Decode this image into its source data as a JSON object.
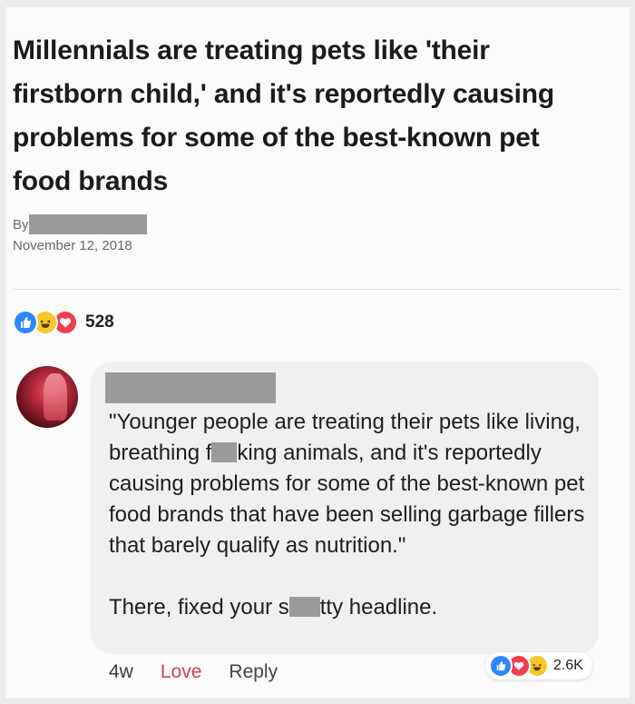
{
  "article": {
    "headline": "Millennials are treating pets like 'their firstborn child,' and it's reportedly causing problems for some of the best-known pet food brands",
    "byline_label": "By",
    "date": "November 12, 2018"
  },
  "post_reactions": {
    "count": "528",
    "icons": [
      "like-icon",
      "haha-icon",
      "love-icon"
    ]
  },
  "comment": {
    "text_part1": "\"Younger people are treating their pets like living, breathing f",
    "text_part2": "king animals, and it's reportedly causing problems for some of the best-known pet food brands that have been selling garbage fillers that barely qualify as nutrition.\"",
    "text2_part1": "There, fixed your s",
    "text2_part2": "tty headline.",
    "reaction_count": "2.6K",
    "reaction_icons": [
      "like-icon",
      "love-icon",
      "haha-icon"
    ],
    "timestamp": "4w",
    "love_label": "Love",
    "reply_label": "Reply"
  },
  "colors": {
    "like": "#2d86ff",
    "love": "#f23c4f",
    "haha": "#f7c72e",
    "love_action": "#d4404c"
  }
}
